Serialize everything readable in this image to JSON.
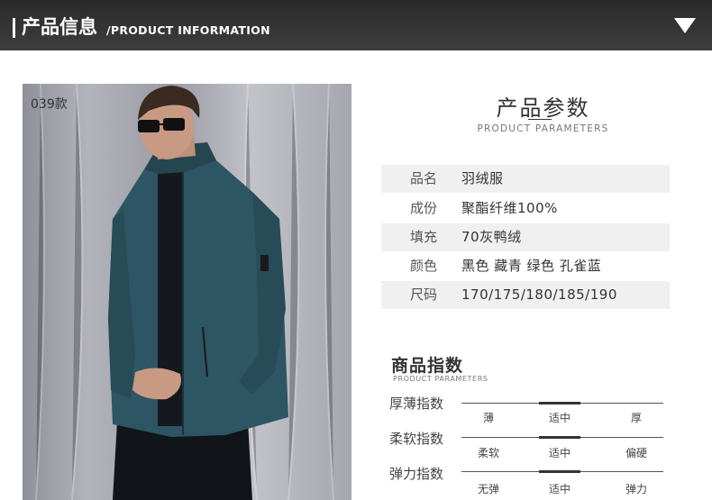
{
  "header": {
    "title": "产品信息",
    "subtitle": "/PRODUCT INFORMATION"
  },
  "photo": {
    "code": "039款"
  },
  "params": {
    "title": "产品参数",
    "subtitle": "PRODUCT PARAMETERS",
    "rows": [
      {
        "label": "品名",
        "value": "羽绒服"
      },
      {
        "label": "成份",
        "value": "聚酯纤维100%"
      },
      {
        "label": "填充",
        "value": "70灰鸭绒"
      },
      {
        "label": "颜色",
        "value": "黑色 藏青 绿色 孔雀蓝"
      },
      {
        "label": "尺码",
        "value": "170/175/180/185/190"
      }
    ]
  },
  "index": {
    "title": "商品指数",
    "subtitle": "PRODUCT PARAMETERS",
    "rows": [
      {
        "label": "厚薄指数",
        "options": [
          "薄",
          "适中",
          "厚"
        ],
        "selected": "适中"
      },
      {
        "label": "柔软指数",
        "options": [
          "柔软",
          "适中",
          "偏硬"
        ],
        "selected": "适中"
      },
      {
        "label": "弹力指数",
        "options": [
          "无弹",
          "适中",
          "弹力"
        ],
        "selected": "适中"
      }
    ]
  },
  "colors": {
    "header_bg": "#333333",
    "jacket": "#2e5563",
    "shaded_row": "#f0f0f0"
  }
}
